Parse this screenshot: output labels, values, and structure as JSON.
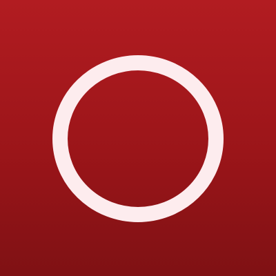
{
  "app_icon": {
    "icon": "ring-icon",
    "colors": {
      "background_top": "#b21c21",
      "background_mid": "#9b1519",
      "background_bottom": "#7f1114",
      "ring": "#fdecee"
    }
  }
}
